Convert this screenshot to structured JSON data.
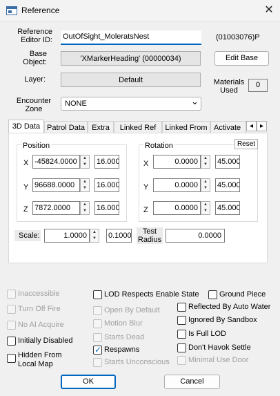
{
  "window": {
    "title": "Reference",
    "close_glyph": "✕"
  },
  "editor_id": {
    "label_line1": "Reference",
    "label_line2": "Editor ID:",
    "value": "OutOfSight_MoleratsNest",
    "form_id": "(01003076)P"
  },
  "base_object": {
    "label_line1": "Base",
    "label_line2": "Object:",
    "value": "'XMarkerHeading' (00000034)",
    "edit_button": "Edit Base"
  },
  "layer": {
    "label": "Layer:",
    "value": "Default"
  },
  "materials": {
    "label_line1": "Materials",
    "label_line2": "Used",
    "value": "0"
  },
  "encounter_zone": {
    "label_line1": "Encounter",
    "label_line2": "Zone",
    "value": "NONE"
  },
  "tabs": [
    "3D Data",
    "Patrol Data",
    "Extra",
    "Linked Ref",
    "Linked From",
    "Activate P"
  ],
  "scroll_left": "◂",
  "scroll_right": "▸",
  "position": {
    "title": "Position",
    "rows": [
      {
        "axis": "X",
        "value": "-45824.0000",
        "step": "16.000"
      },
      {
        "axis": "Y",
        "value": "96688.0000",
        "step": "16.000"
      },
      {
        "axis": "Z",
        "value": "7872.0000",
        "step": "16.000"
      }
    ]
  },
  "rotation": {
    "title": "Rotation",
    "reset": "Reset",
    "rows": [
      {
        "axis": "X",
        "value": "0.0000",
        "step": "45.000"
      },
      {
        "axis": "Y",
        "value": "0.0000",
        "step": "45.000"
      },
      {
        "axis": "Z",
        "value": "0.0000",
        "step": "45.000"
      }
    ]
  },
  "scale": {
    "label": "Scale:",
    "value": "1.0000",
    "step": "0.1000"
  },
  "test_radius": {
    "label_line1": "Test",
    "label_line2": "Radius",
    "value": "0.0000"
  },
  "checks_left": [
    {
      "label": "Inaccessible",
      "checked": false,
      "enabled": false
    },
    {
      "label": "Turn Off Fire",
      "checked": false,
      "enabled": false
    },
    {
      "label": "No AI Acquire",
      "checked": false,
      "enabled": false
    },
    {
      "label": "Initially Disabled",
      "checked": false,
      "enabled": true
    },
    {
      "label": "Hidden From",
      "label2": "Local Map",
      "checked": false,
      "enabled": true
    }
  ],
  "checks_mid": [
    {
      "label": "LOD Respects Enable State",
      "checked": false,
      "enabled": true
    },
    {
      "label": "Open By Default",
      "checked": false,
      "enabled": false
    },
    {
      "label": "Motion Blur",
      "checked": false,
      "enabled": false
    },
    {
      "label": "Starts Dead",
      "checked": false,
      "enabled": false
    },
    {
      "label": "Respawns",
      "checked": true,
      "enabled": true
    },
    {
      "label": "Starts Unconscious",
      "checked": false,
      "enabled": false
    }
  ],
  "checks_right": [
    {
      "label": "Ground Piece",
      "checked": false,
      "enabled": true
    },
    {
      "label": "Reflected By Auto Water",
      "checked": false,
      "enabled": true
    },
    {
      "label": "Ignored By Sandbox",
      "checked": false,
      "enabled": true
    },
    {
      "label": "Is Full LOD",
      "checked": false,
      "enabled": true
    },
    {
      "label": "Don't Havok Settle",
      "checked": false,
      "enabled": true
    },
    {
      "label": "Minimal Use Door",
      "checked": false,
      "enabled": false
    }
  ],
  "buttons": {
    "ok": "OK",
    "cancel": "Cancel"
  },
  "spin_up": "▲",
  "spin_down": "▼",
  "dropdown_glyph": "⌄"
}
